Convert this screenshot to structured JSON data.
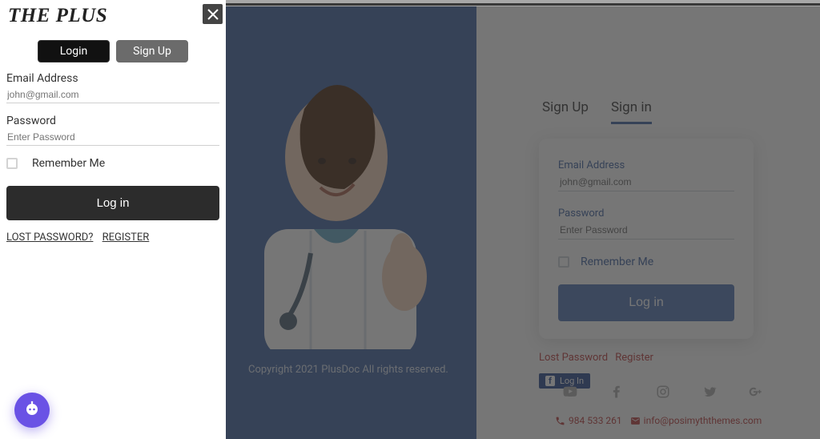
{
  "brand": "THE PLUS",
  "panel": {
    "tabs": {
      "login": "Login",
      "signup": "Sign Up"
    },
    "email_label": "Email Address",
    "email_placeholder": "john@gmail.com",
    "password_label": "Password",
    "password_placeholder": "Enter Password",
    "remember": "Remember Me",
    "submit": "Log in",
    "lost": "LOST PASSWORD?",
    "register": "REGISTER"
  },
  "bg": {
    "copyright": "Copyright 2021 PlusDoc All rights reserved.",
    "tabs": {
      "signup": "Sign Up",
      "signin": "Sign in"
    },
    "form": {
      "email_label": "Email Address",
      "email_placeholder": "john@gmail.com",
      "password_label": "Password",
      "password_placeholder": "Enter Password",
      "remember": "Remember Me",
      "submit": "Log in",
      "lost": "Lost Password",
      "register": "Register"
    },
    "fb_login": "Log In",
    "contact": {
      "phone": "984 533 261",
      "email": "info@posimyththemes.com"
    }
  }
}
